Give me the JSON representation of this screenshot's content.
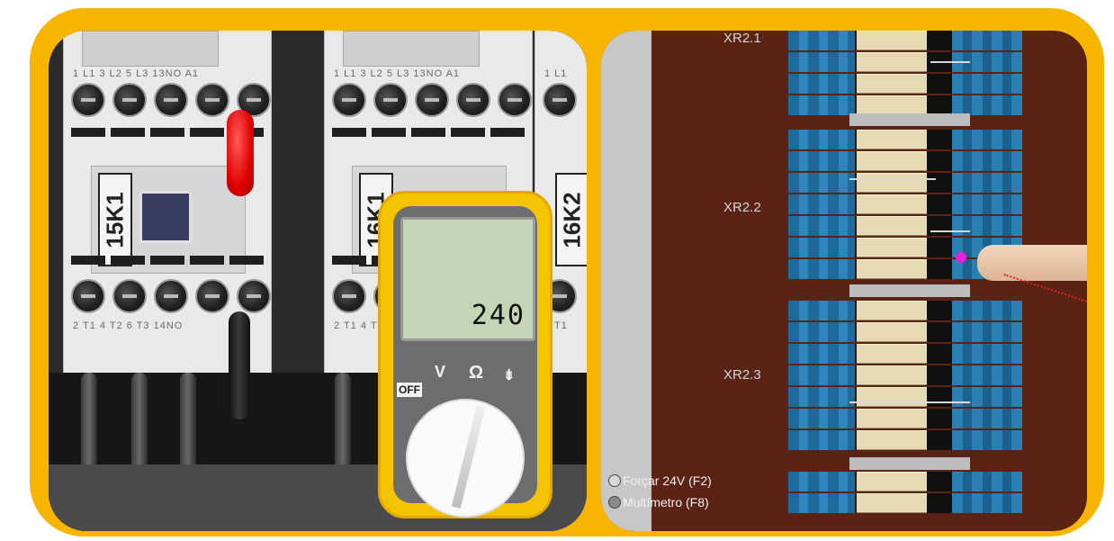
{
  "left_view": {
    "contactors": [
      {
        "label": "15K1",
        "top_terminals": "1 L1  3 L2  5 L3  13NO  A1",
        "bottom_terminals": "2 T1  4 T2  6 T3  14NO"
      },
      {
        "label": "16K1",
        "top_terminals": "1 L1  3 L2  5 L3  13NO  A1",
        "bottom_terminals": "2 T1  4 T2  6 T3  14NO"
      },
      {
        "label": "16K2",
        "top_terminals": "1 L1",
        "bottom_terminals": "2 T1"
      }
    ],
    "multimeter": {
      "reading": "240",
      "off_label": "OFF",
      "v_label": "V",
      "ohm_label": "Ω",
      "diode_label": "⇟"
    }
  },
  "right_view": {
    "groups": [
      {
        "label": "XR2.1"
      },
      {
        "label": "XR2.2"
      },
      {
        "label": "XR2.3"
      }
    ],
    "controls": [
      {
        "label": "Forçar 24V (F2)",
        "state": "on"
      },
      {
        "label": "Multímetro (F8)",
        "state": "off"
      }
    ]
  },
  "colors": {
    "frame": "#f7b500",
    "panel_brown": "#5a2315",
    "terminal_blue": "#2f86bd",
    "probe_red": "#e00000",
    "lcd": "#c4d4b5"
  }
}
